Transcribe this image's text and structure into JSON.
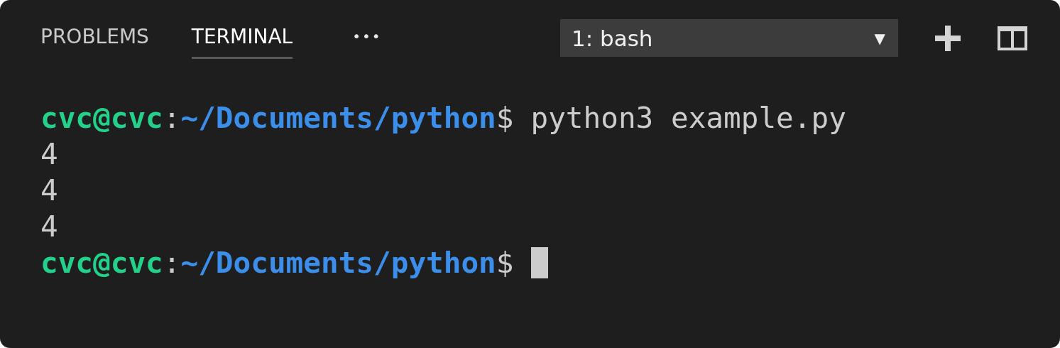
{
  "panel": {
    "tabs": [
      {
        "label": "PROBLEMS",
        "selected": false
      },
      {
        "label": "TERMINAL",
        "selected": true
      }
    ],
    "more": "•••",
    "terminal_select": {
      "value": "1: bash",
      "arrow": "▼"
    }
  },
  "terminal": {
    "lines": [
      {
        "kind": "prompt",
        "user": "cvc@cvc",
        "separator": ":",
        "path": "~/Documents/python",
        "symbol": "$",
        "command": "python3 example.py",
        "cursor": false
      },
      {
        "kind": "output",
        "text": "4"
      },
      {
        "kind": "output",
        "text": "4"
      },
      {
        "kind": "output",
        "text": "4"
      },
      {
        "kind": "prompt",
        "user": "cvc@cvc",
        "separator": ":",
        "path": "~/Documents/python",
        "symbol": "$",
        "cursor": true
      }
    ]
  }
}
